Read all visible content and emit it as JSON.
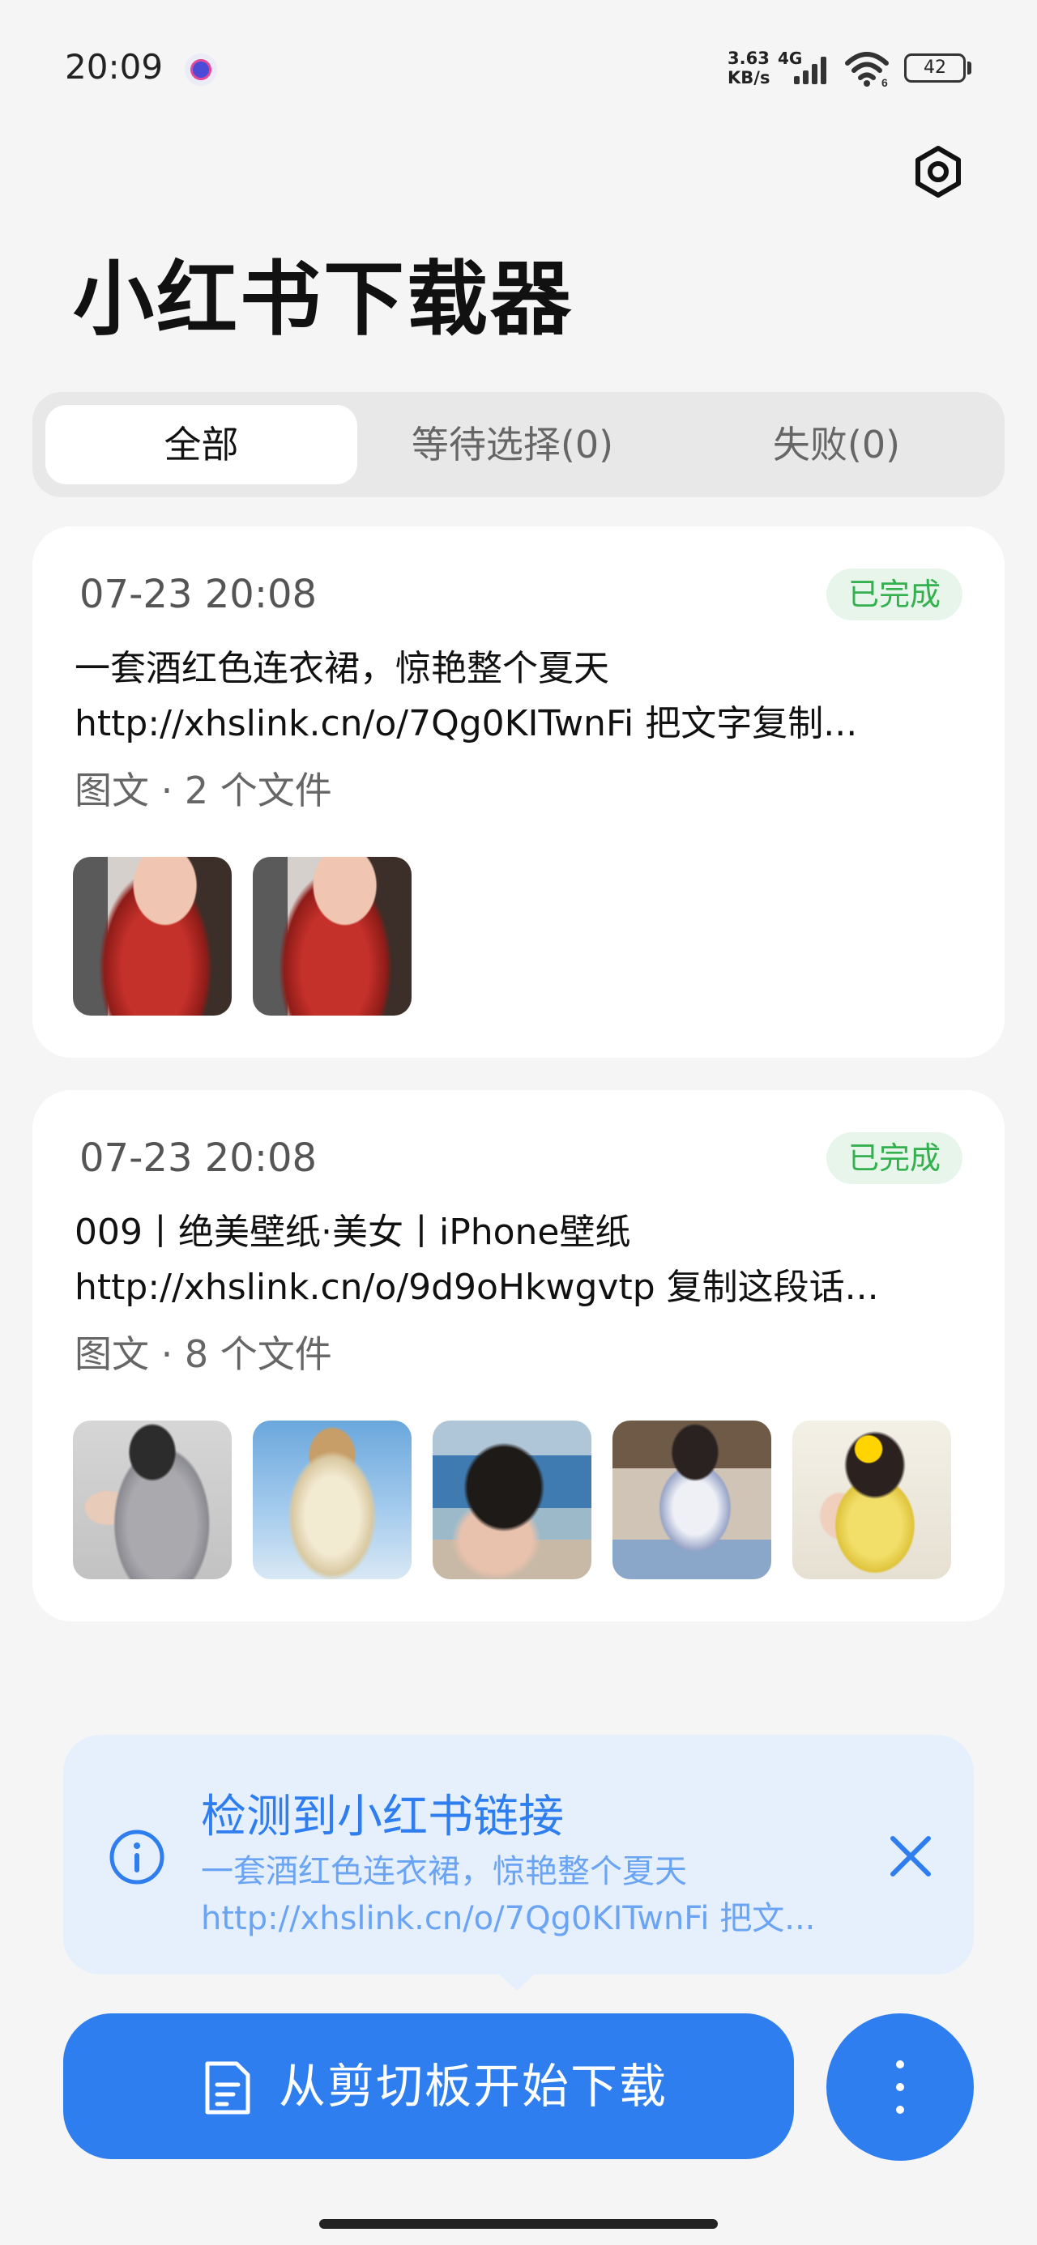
{
  "status_bar": {
    "time": "20:09",
    "net_speed_value": "3.63",
    "net_speed_unit": "KB/s",
    "network_type": "4G",
    "wifi_label": "6",
    "battery": "42"
  },
  "header": {
    "title": "小红书下载器",
    "settings_icon": "gear-icon"
  },
  "tabs": [
    {
      "label": "全部",
      "active": true
    },
    {
      "label": "等待选择(0)",
      "active": false
    },
    {
      "label": "失败(0)",
      "active": false
    }
  ],
  "cards": [
    {
      "date": "07-23 20:08",
      "status": "已完成",
      "title": "一套酒红色连衣裙，惊艳整个夏天",
      "link_text": "http://xhslink.cn/o/7Qg0KITwnFi 把文字复制...",
      "meta": "图文 · 2 个文件",
      "thumbnail_count": 2
    },
    {
      "date": "07-23 20:08",
      "status": "已完成",
      "title": "009丨绝美壁纸·美女丨iPhone壁纸",
      "link_text": "http://xhslink.cn/o/9d9oHkwgvtp 复制这段话...",
      "meta": "图文 · 8 个文件",
      "thumbnail_count": 5
    }
  ],
  "clipboard_toast": {
    "title": "检测到小红书链接",
    "line1": "一套酒红色连衣裙，惊艳整个夏天",
    "line2": "http://xhslink.cn/o/7Qg0KITwnFi 把文...",
    "icon": "info-icon",
    "close_icon": "close-icon"
  },
  "actions": {
    "download_label": "从剪切板开始下载",
    "download_icon": "clipboard-icon",
    "more_icon": "more-vertical-icon"
  },
  "colors": {
    "accent": "#2f7ef0",
    "success": "#35b04f",
    "success_bg": "#e7f5ea",
    "toast_bg": "#e6f0fd",
    "background": "#f5f5f5"
  }
}
